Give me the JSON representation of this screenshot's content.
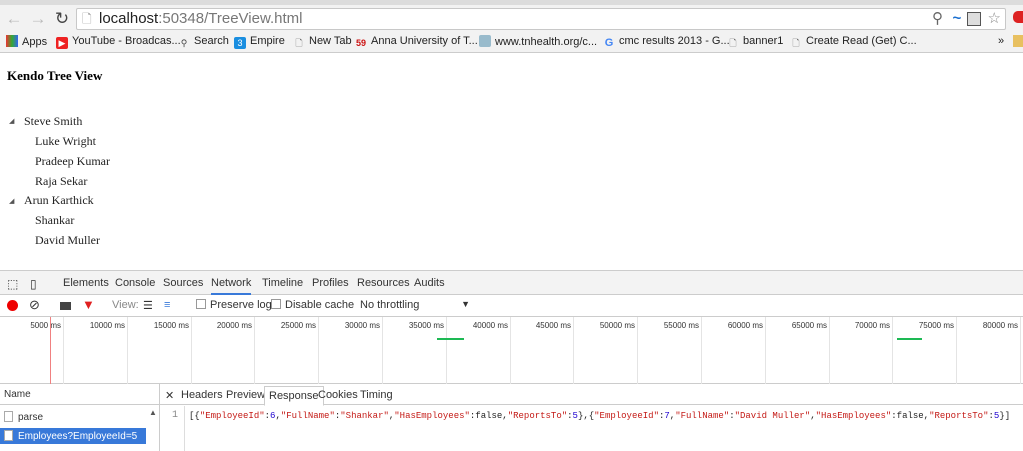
{
  "browser": {
    "url_host": "localhost",
    "url_rest": ":50348/TreeView.html",
    "bookmarks": [
      "Apps",
      "YouTube - Broadcas...",
      "Search",
      "Empire",
      "New Tab",
      "Anna University of T...",
      "www.tnhealth.org/c...",
      "cmc results 2013 - G...",
      "banner1",
      "Create Read (Get) C..."
    ],
    "more": "»"
  },
  "page": {
    "title": "Kendo Tree View",
    "tree": [
      {
        "label": "Steve Smith",
        "children": [
          "Luke Wright",
          "Pradeep Kumar",
          "Raja Sekar"
        ]
      },
      {
        "label": "Arun Karthick",
        "children": [
          "Shankar",
          "David Muller"
        ]
      }
    ]
  },
  "devtools": {
    "tabs": [
      "Elements",
      "Console",
      "Sources",
      "Network",
      "Timeline",
      "Profiles",
      "Resources",
      "Audits"
    ],
    "active_tab": "Network",
    "toolbar": {
      "view": "View:",
      "preserve_log": "Preserve log",
      "disable_cache": "Disable cache",
      "throttling": "No throttling"
    },
    "ticks": [
      "5000 ms",
      "10000 ms",
      "15000 ms",
      "20000 ms",
      "25000 ms",
      "30000 ms",
      "35000 ms",
      "40000 ms",
      "45000 ms",
      "50000 ms",
      "55000 ms",
      "60000 ms",
      "65000 ms",
      "70000 ms",
      "75000 ms",
      "80000 ms"
    ],
    "name_header": "Name",
    "requests": [
      "parse",
      "Employees?EmployeeId=5"
    ],
    "detail_tabs": [
      "Headers",
      "Preview",
      "Response",
      "Cookies",
      "Timing"
    ],
    "active_detail": "Response",
    "line_no": "1",
    "response": [
      [
        "p",
        "[{"
      ],
      [
        "k",
        "\"EmployeeId\""
      ],
      [
        "p",
        ":"
      ],
      [
        "n",
        "6"
      ],
      [
        "p",
        ","
      ],
      [
        "k",
        "\"FullName\""
      ],
      [
        "p",
        ":"
      ],
      [
        "k",
        "\"Shankar\""
      ],
      [
        "p",
        ","
      ],
      [
        "k",
        "\"HasEmployees\""
      ],
      [
        "p",
        ":false,"
      ],
      [
        "k",
        "\"ReportsTo\""
      ],
      [
        "p",
        ":"
      ],
      [
        "n",
        "5"
      ],
      [
        "p",
        "},{"
      ],
      [
        "k",
        "\"EmployeeId\""
      ],
      [
        "p",
        ":"
      ],
      [
        "n",
        "7"
      ],
      [
        "p",
        ","
      ],
      [
        "k",
        "\"FullName\""
      ],
      [
        "p",
        ":"
      ],
      [
        "k",
        "\"David Muller\""
      ],
      [
        "p",
        ","
      ],
      [
        "k",
        "\"HasEmployees\""
      ],
      [
        "p",
        ":false,"
      ],
      [
        "k",
        "\"ReportsTo\""
      ],
      [
        "p",
        ":"
      ],
      [
        "n",
        "5"
      ],
      [
        "p",
        "}]"
      ]
    ]
  }
}
